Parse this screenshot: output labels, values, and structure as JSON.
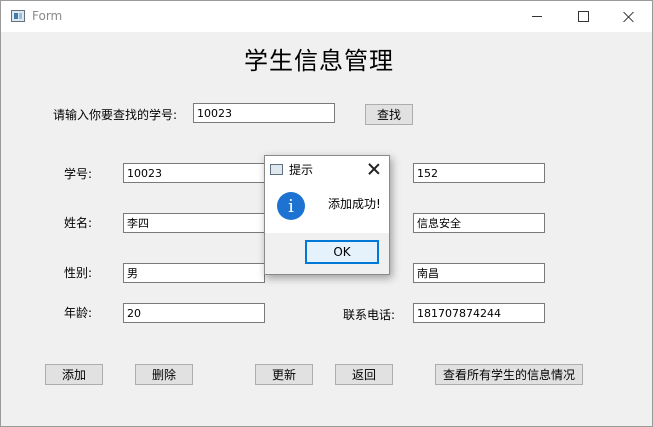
{
  "window": {
    "title": "Form"
  },
  "header": {
    "title": "学生信息管理"
  },
  "search": {
    "label": "请输入你要查找的学号:",
    "value": "10023",
    "button_label": "查找"
  },
  "form": {
    "student_id": {
      "label": "学号:",
      "value": "10023"
    },
    "name": {
      "label": "姓名:",
      "value": "李四"
    },
    "gender": {
      "label": "性别:",
      "value": "男"
    },
    "age": {
      "label": "年龄:",
      "value": "20"
    },
    "right_field_1": {
      "value": "152"
    },
    "right_field_2": {
      "value": "信息安全"
    },
    "right_field_3": {
      "value": "南昌"
    },
    "phone": {
      "label": "联系电话:",
      "value": "181707874244"
    }
  },
  "actions": {
    "add": "添加",
    "delete": "删除",
    "update": "更新",
    "back": "返回",
    "view_all": "查看所有学生的信息情况"
  },
  "dialog": {
    "title": "提示",
    "message": "添加成功!",
    "ok_label": "OK",
    "icon": "info-icon",
    "icon_glyph": "i"
  },
  "colors": {
    "accent": "#0078d7",
    "info_icon": "#1e73d2",
    "window_bg": "#f0f0f0"
  }
}
